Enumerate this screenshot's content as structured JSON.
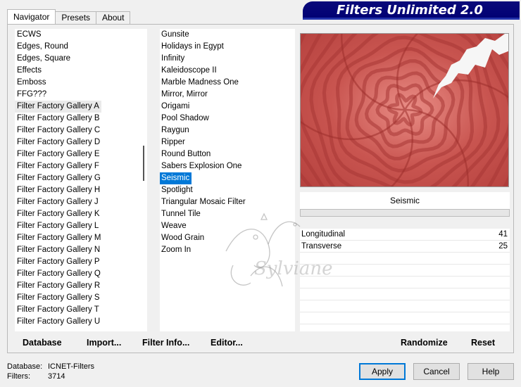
{
  "tabs": [
    "Navigator",
    "Presets",
    "About"
  ],
  "banner_title": "Filters Unlimited 2.0",
  "categories": [
    "ECWS",
    "Edges, Round",
    "Edges, Square",
    "Effects",
    "Emboss",
    "FFG???",
    "Filter Factory Gallery A",
    "Filter Factory Gallery B",
    "Filter Factory Gallery C",
    "Filter Factory Gallery D",
    "Filter Factory Gallery E",
    "Filter Factory Gallery F",
    "Filter Factory Gallery G",
    "Filter Factory Gallery H",
    "Filter Factory Gallery J",
    "Filter Factory Gallery K",
    "Filter Factory Gallery L",
    "Filter Factory Gallery M",
    "Filter Factory Gallery N",
    "Filter Factory Gallery P",
    "Filter Factory Gallery Q",
    "Filter Factory Gallery R",
    "Filter Factory Gallery S",
    "Filter Factory Gallery T",
    "Filter Factory Gallery U"
  ],
  "highlighted_category": "Filter Factory Gallery A",
  "filters": [
    "Gunsite",
    "Holidays in Egypt",
    "Infinity",
    "Kaleidoscope II",
    "Marble Madness One",
    "Mirror, Mirror",
    "Origami",
    "Pool Shadow",
    "Raygun",
    "Ripper",
    "Round Button",
    "Sabers Explosion One",
    "Seismic",
    "Spotlight",
    "Triangular Mosaic Filter",
    "Tunnel Tile",
    "Weave",
    "Wood Grain",
    "Zoom In"
  ],
  "selected_filter": "Seismic",
  "current_filter_name": "Seismic",
  "params": [
    {
      "name": "Longitudinal",
      "value": "41"
    },
    {
      "name": "Transverse",
      "value": "25"
    }
  ],
  "watermark_text": "Sylviane",
  "buttons_left": {
    "database": "Database",
    "import": "Import...",
    "filter_info": "Filter Info...",
    "editor": "Editor..."
  },
  "buttons_right": {
    "randomize": "Randomize",
    "reset": "Reset"
  },
  "status": {
    "database_label": "Database:",
    "database_value": "ICNET-Filters",
    "filters_label": "Filters:",
    "filters_value": "3714"
  },
  "dialog_buttons": {
    "apply": "Apply",
    "cancel": "Cancel",
    "help": "Help"
  },
  "colors": {
    "banner": "#000073",
    "selection": "#0078d7",
    "preview_base": "#c8504c"
  },
  "icons": {}
}
